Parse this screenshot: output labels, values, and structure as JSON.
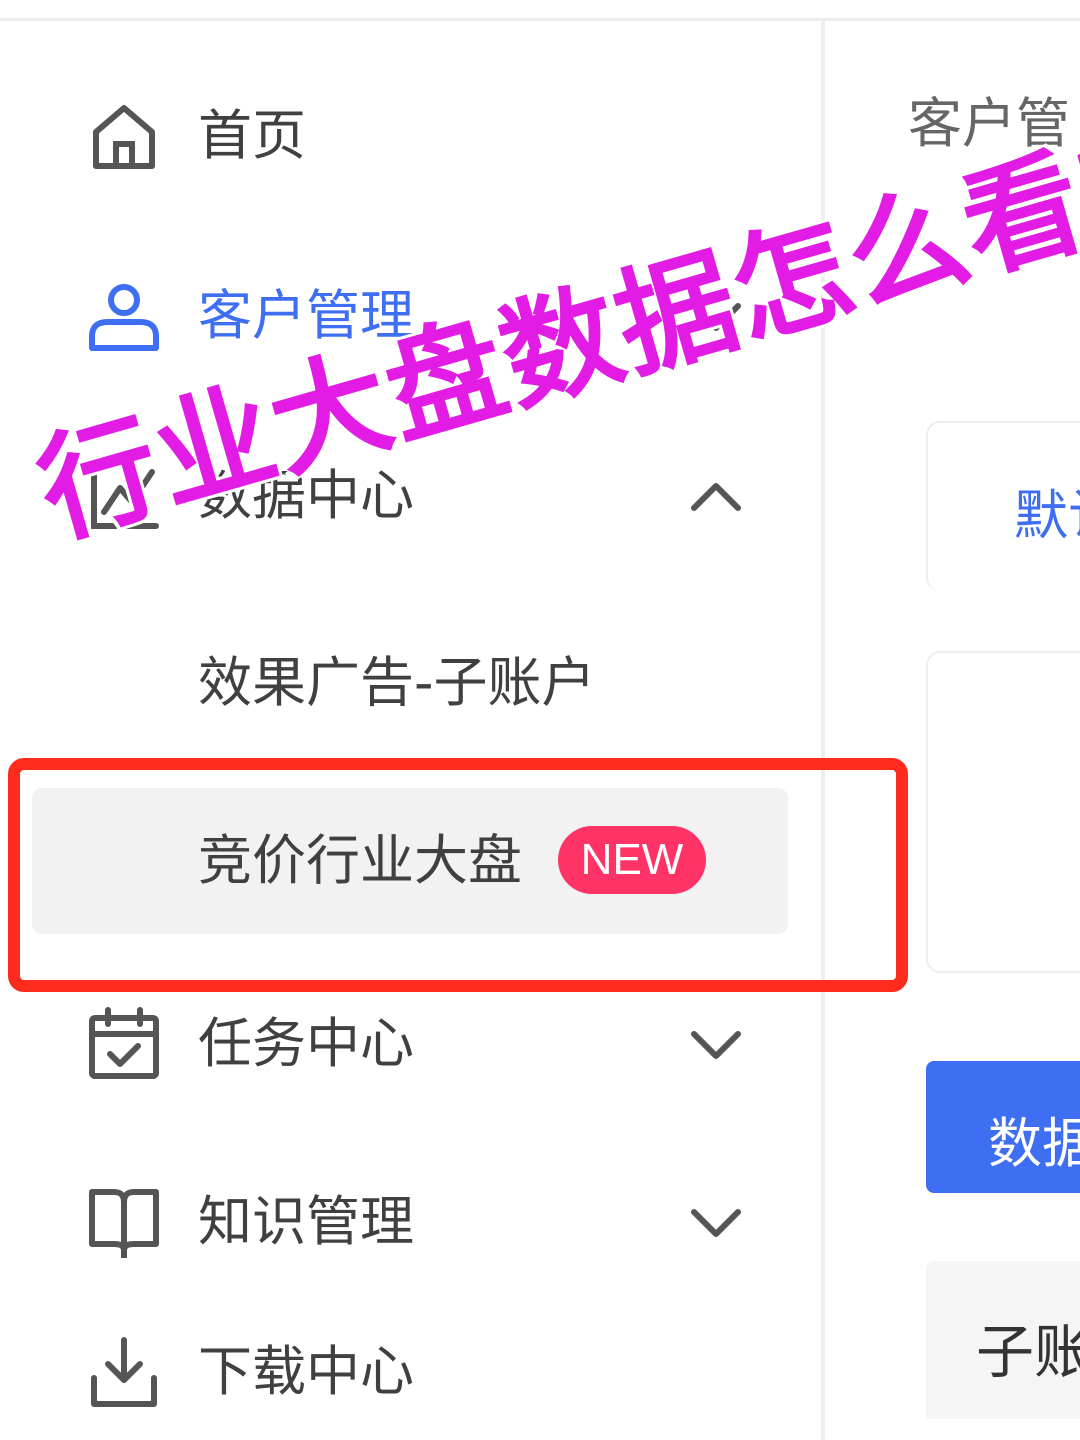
{
  "sidebar": {
    "items": [
      {
        "label": "首页",
        "icon": "home-icon"
      },
      {
        "label": "客户管理",
        "icon": "user-icon",
        "active": true
      },
      {
        "label": "数据中心",
        "icon": "line-chart-icon",
        "expanded": true
      },
      {
        "label": "任务中心",
        "icon": "calendar-check-icon"
      },
      {
        "label": "知识管理",
        "icon": "book-open-icon"
      },
      {
        "label": "下载中心",
        "icon": "download-icon"
      }
    ],
    "sub_items": [
      {
        "label": "效果广告-子账户"
      },
      {
        "label": "竞价行业大盘",
        "badge": "NEW",
        "selected": true
      }
    ]
  },
  "overlay": {
    "title": "行业大盘数据怎么看?"
  },
  "main": {
    "breadcrumb": "客户管",
    "tab_label": "默认",
    "button_label": "数据",
    "row_label": "子账"
  },
  "colors": {
    "accent": "#3e6ef2",
    "badge": "#ff3366",
    "highlight": "#ff2b1c",
    "overlay_text": "#e21ce5"
  }
}
